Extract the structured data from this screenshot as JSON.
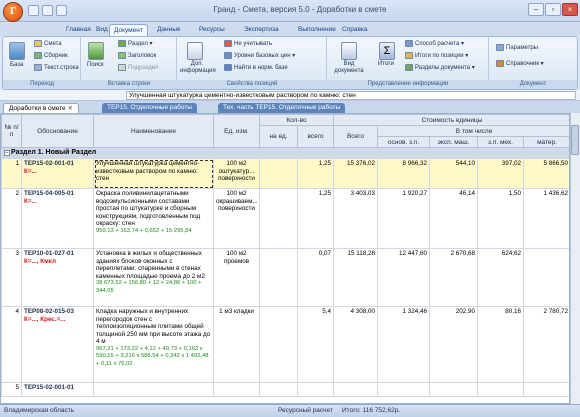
{
  "window": {
    "title": "Гранд - Смета, версия 5.0 - Доработки в смете"
  },
  "ribbon_tabs": [
    "Главная",
    "Вид",
    "Документ",
    "Данные",
    "Ресурсы",
    "Экспертиза",
    "Выполнение",
    "Справка"
  ],
  "ribbon": {
    "base": "База",
    "smeta": "Смета",
    "sbornik": "Сборник",
    "text_stroka": "Текст.строка",
    "group_perehod": "Переход",
    "razdel": "Раздел",
    "zagolovok": "Заголовок",
    "poisk": "Поиск",
    "podrazdel": "Подраздел",
    "group_vstavka": "Вставка строки",
    "dop_info": "Доп. информация",
    "ne_uchityvat": "Не учитывать",
    "urovni": "Уровни базовых цен",
    "nayti": "Найти в норм. базе",
    "group_svoystva": "Свойства позиций",
    "vid_doc": "Вид документа",
    "itogi": "Итоги",
    "sposob": "Способ расчета",
    "itogi_poz": "Итоги по позиции",
    "razdely": "Разделы документа",
    "group_predst": "Представление информации",
    "parametry": "Параметры",
    "spravochnik": "Справочник",
    "group_document": "Документ"
  },
  "formula_text": "Улучшенная штукатурка цементно-известковым раствором по камню: стен",
  "doc_tabs": [
    "Доработки в смете",
    "ТЕР15. Отделочные работы",
    "Тех. часть ТЕР15. Отделочные работы"
  ],
  "table": {
    "headers": {
      "num": "№ п/п",
      "basis": "Обоснование",
      "name": "Наименование",
      "unit": "Ед. изм.",
      "qty": "Кол-во",
      "qty_per": "на ед.",
      "qty_total": "всего",
      "total": "Всего",
      "cost": "Стоимость единицы",
      "incl": "В том числе",
      "osn": "основ. з.п.",
      "eksp": "эксп. маш.",
      "zpmash": "з.п. мех.",
      "mat": "матер."
    },
    "section_title": "Раздел 1. Новый Раздел",
    "rows": [
      {
        "num": "1",
        "code": "ТЕР15-02-001-01",
        "k": "К=...",
        "name": "Улучшенная штукатурка цементно-известковым раствором по камню: стен",
        "unit": "100 м2 оштукатур... поверхности",
        "qty_per": "",
        "qty_total": "1,25",
        "total": "15 376,02",
        "osn": "8 966,32",
        "eksp": "544,10",
        "zpmash": "397,02",
        "mat": "5 866,50",
        "formula": ""
      },
      {
        "num": "2",
        "code": "ТЕР15-04-005-01",
        "k": "К=...",
        "name": "Окраска поливинилацетатными водоэмульсионными составами простая по штукатурке и сборным конструкциям, подготовленным под окраску: стен",
        "unit": "100 м2 окрашиваем... поверхности",
        "qty_per": "",
        "qty_total": "1,25",
        "total": "3 403,03",
        "osn": "1 920,27",
        "eksp": "46,14",
        "zpmash": "1,50",
        "mat": "1 436,62",
        "formula": "959,13 + 163,74 + 0,652 + 15 295,84"
      },
      {
        "num": "3",
        "code": "ТЕР10-01-027-01",
        "k": "К=..., Кмкл",
        "name": "Установка в жилых и общественных зданиях блоков оконных с переплетами: спаренными в стенах каменных площадью проема до 2 м2",
        "unit": "100 м2 проемов",
        "qty_per": "",
        "qty_total": "0,07",
        "total": "15 118,28",
        "osn": "12 447,60",
        "eksp": "2 670,68",
        "zpmash": "624,62",
        "mat": "",
        "formula": "38 673,52 + 156,80 + 12 + 24,86 + 100 + 344,05"
      },
      {
        "num": "4",
        "code": "ТЕР08-02-015-03",
        "k": "К=..., Крес.=...",
        "name": "Кладка наружных и внутренних перегородок стен с теплоизоляционным плитами общей толщиной 250 мм при высоте этажа до 4 м",
        "unit": "1 м3 кладки",
        "qty_per": "",
        "qty_total": "5,4",
        "total": "4 308,00",
        "osn": "1 324,46",
        "eksp": "202,90",
        "zpmash": "80,16",
        "mat": "2 780,72",
        "formula": "967,21 + 173,22 + 4,12 + 49,73 + 0,162 x 590,15 + 3,216 x 588,54 + 0,342 x 1 492,48 + 0,11 x 76,02"
      }
    ],
    "partial_row_code": "ТЕР15-02-001-01"
  },
  "status": {
    "left": "Владимирская область",
    "mode": "Ресурсный расчет",
    "total": "Итого: 116 752,62р."
  }
}
